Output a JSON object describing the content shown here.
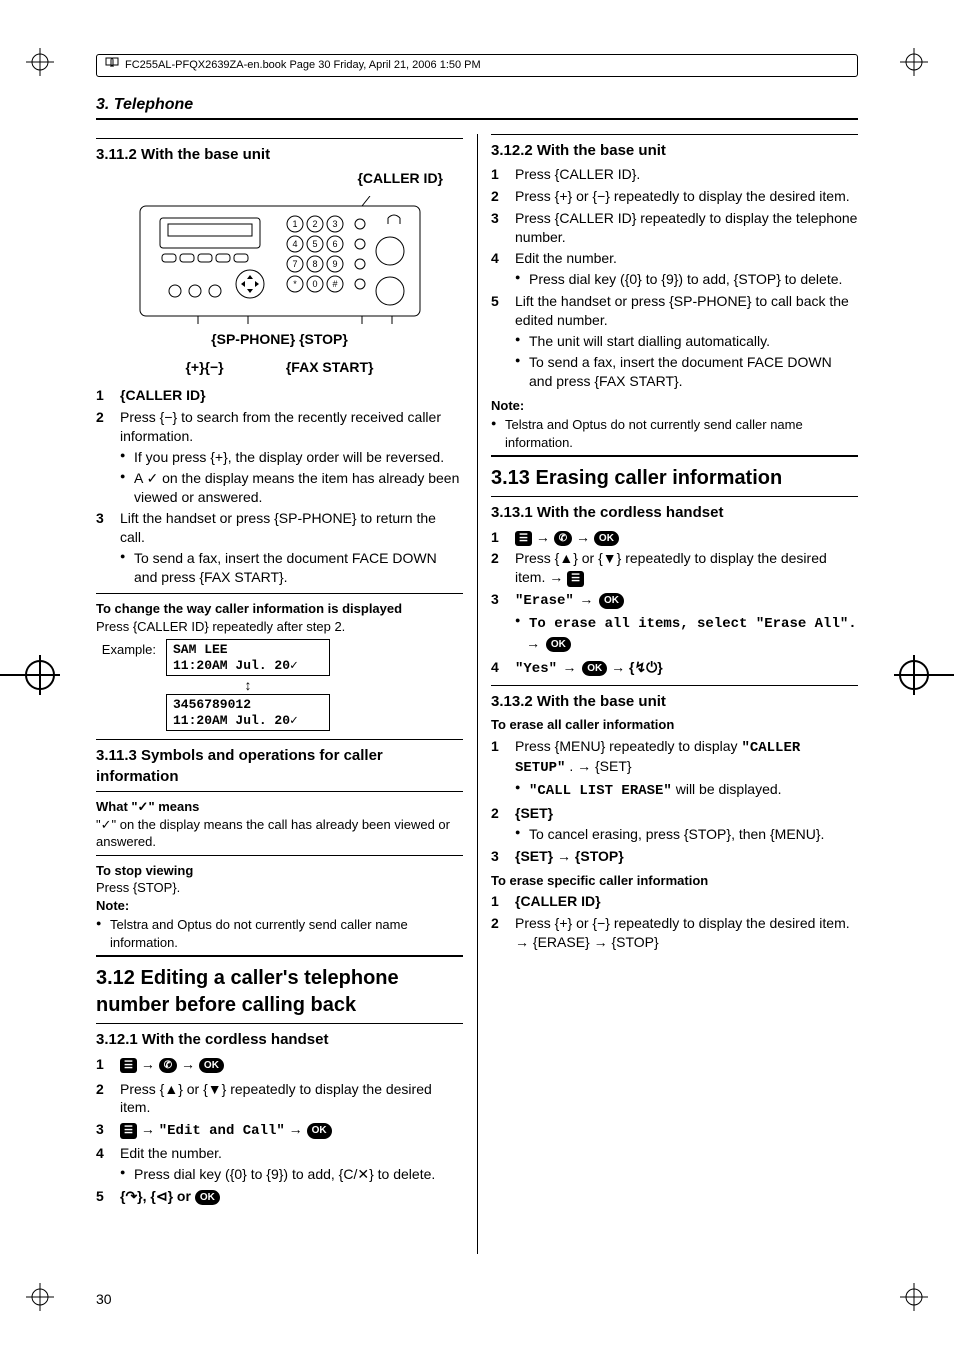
{
  "runhead": "FC255AL-PFQX2639ZA-en.book  Page 30  Friday, April 21, 2006  1:50 PM",
  "chapter": "3. Telephone",
  "page_number": "30",
  "s3_11_2": {
    "title": "3.11.2 With the base unit",
    "callouts": {
      "top": "{CALLER ID}",
      "row1": "{SP-PHONE}  {STOP}",
      "row2": "{+}{−}                {FAX START}"
    },
    "steps": [
      "{CALLER ID}",
      "Press {−} to search from the recently received caller information.",
      "Lift the handset or press {SP-PHONE} to return the call."
    ],
    "step2_bullets": [
      "If you press {+}, the display order will be reversed.",
      "A ✓ on the display means the item has already been viewed or answered."
    ],
    "step3_bullets": [
      "To send a fax, insert the document FACE DOWN and press {FAX START}."
    ],
    "change_title": "To change the way caller information is displayed",
    "change_text": "Press {CALLER ID} repeatedly after step 2.",
    "example_label": "Example:",
    "example_top_line1": "SAM LEE",
    "example_top_line2": "11:20AM Jul. 20✓",
    "example_bot_line1": "3456789012",
    "example_bot_line2": "11:20AM Jul. 20✓"
  },
  "s3_11_3": {
    "title": "3.11.3 Symbols and operations for caller information",
    "sub1_title": "What \"✓\" means",
    "sub1_text": "\"✓\" on the display means the call has already been viewed or answered.",
    "sub2_title": "To stop viewing",
    "sub2_text": "Press {STOP}.",
    "note_label": "Note:",
    "note_bullets": [
      "Telstra and Optus do not currently send caller name information."
    ]
  },
  "s3_12": {
    "title": "3.12 Editing a caller's telephone number before calling back"
  },
  "s3_12_1": {
    "title": "3.12.1 With the cordless handset",
    "step1": "1",
    "step1_seq": [
      "menu",
      "arrow",
      "phonebook",
      "arrow",
      "ok"
    ],
    "step2": "Press {▲} or {▼} repeatedly to display the desired item.",
    "step3_pre": "",
    "step3_quote": "\"Edit and Call\"",
    "step3_seq_a": [
      "menu",
      "arrow"
    ],
    "step3_seq_b": [
      "arrow",
      "ok"
    ],
    "step4": "Edit the number.",
    "step4_bullets": [
      "Press dial key ({0} to {9}) to add, {C/✕} to delete."
    ],
    "step5_pre": "{↷}, {⊲} or ",
    "step5_ok": "ok"
  },
  "s3_12_2": {
    "title": "3.12.2 With the base unit",
    "steps": [
      "Press {CALLER ID}.",
      "Press {+} or {−} repeatedly to display the desired item.",
      "Press {CALLER ID} repeatedly to display the telephone number.",
      "Edit the number.",
      "Lift the handset or press {SP-PHONE} to call back the edited number."
    ],
    "step4_bullets": [
      "Press dial key ({0} to {9}) to add, {STOP} to delete."
    ],
    "step5_bullets": [
      "The unit will start dialling automatically.",
      "To send a fax, insert the document FACE DOWN and press {FAX START}."
    ],
    "note_label": "Note:",
    "note_bullets": [
      "Telstra and Optus do not currently send caller name information."
    ]
  },
  "s3_13": {
    "title": "3.13 Erasing caller information"
  },
  "s3_13_1": {
    "title": "3.13.1 With the cordless handset",
    "step1_seq": [
      "menu",
      "arrow",
      "phonebook",
      "arrow",
      "ok"
    ],
    "step2": "Press {▲} or {▼} repeatedly to display the desired item. → ",
    "step2_tail_icon": "menu",
    "step3_pre": "\"Erase\" → ",
    "step3_icon": "ok",
    "step3_bullets": [
      "To erase all items, select \"Erase All\". → "
    ],
    "step3_bullet_tail_icon": "ok",
    "step4_pre": "\"Yes\" → ",
    "step4_mid_icon": "ok",
    "step4_tail": " → {↯⏻}"
  },
  "s3_13_2": {
    "title": "3.13.2 With the base unit",
    "subA_title": "To erase all caller information",
    "subA_step1_a": "Press {MENU} repeatedly to display ",
    "subA_step1_q": "\"CALLER SETUP\"",
    "subA_step1_b": ". → {SET}",
    "subA_step1_bullets_a": "",
    "subA_step1_bullet_q": "\"CALL LIST ERASE\"",
    "subA_step1_bullets_b": " will be displayed.",
    "subA_step2": "{SET}",
    "subA_step2_bullets": [
      "To cancel erasing, press {STOP}, then {MENU}."
    ],
    "subA_step3": "{SET} → {STOP}",
    "subB_title": "To erase specific caller information",
    "subB_step1": "{CALLER ID}",
    "subB_step2": "Press {+} or {−} repeatedly to display the desired item. → {ERASE} → {STOP}"
  }
}
